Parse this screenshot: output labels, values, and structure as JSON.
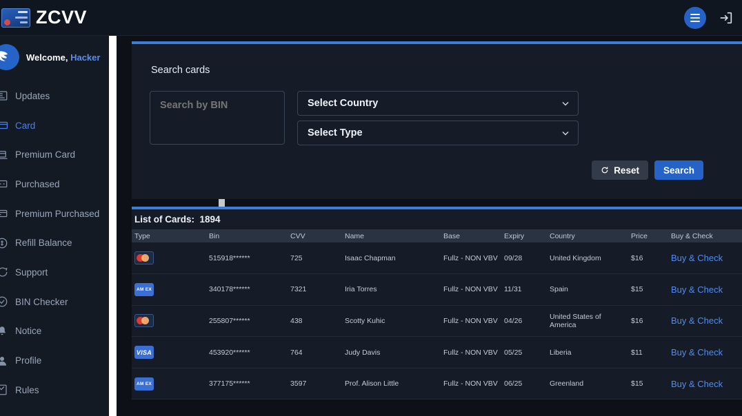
{
  "topbar": {
    "brand_name": "ZCVV",
    "brand_icon": "credit-card-icon",
    "menu_icon": "hamburger-menu-icon",
    "logout_icon": "logout-icon"
  },
  "sidebar": {
    "welcome_prefix": "Welcome,",
    "username": "Hacker",
    "avatar_icon": "user-avatar-icon",
    "items": [
      {
        "label": "Updates",
        "icon": "news-icon",
        "active": false
      },
      {
        "label": "Card",
        "icon": "card-icon",
        "active": true
      },
      {
        "label": "Premium Card",
        "icon": "premium-card-icon",
        "active": false
      },
      {
        "label": "Purchased",
        "icon": "purchased-icon",
        "active": false
      },
      {
        "label": "Premium Purchased",
        "icon": "premium-purchased-icon",
        "active": false
      },
      {
        "label": "Refill Balance",
        "icon": "refill-icon",
        "active": false
      },
      {
        "label": "Support",
        "icon": "support-chat-icon",
        "active": false
      },
      {
        "label": "BIN Checker",
        "icon": "bin-checker-icon",
        "active": false
      },
      {
        "label": "Notice",
        "icon": "bell-icon",
        "active": false
      },
      {
        "label": "Profile",
        "icon": "profile-icon",
        "active": false
      },
      {
        "label": "Rules",
        "icon": "rules-icon",
        "active": false
      }
    ]
  },
  "search_panel": {
    "title": "Search cards",
    "bin_placeholder": "Search by BIN",
    "bin_value": "",
    "country_label": "Select Country",
    "type_label": "Select Type",
    "reset_label": "Reset",
    "search_label": "Search",
    "reset_icon": "refresh-icon",
    "chevron_icon": "chevron-down-icon"
  },
  "list_panel": {
    "title_label": "List of Cards:",
    "count": "1894",
    "columns": [
      "Type",
      "Bin",
      "CVV",
      "Name",
      "Base",
      "Expiry",
      "Country",
      "Price",
      "Buy & Check"
    ],
    "buy_label": "Buy & Check",
    "rows": [
      {
        "type": "mastercard",
        "type_text": "",
        "bin": "515918******",
        "cvv": "725",
        "name": "Isaac Chapman",
        "base": "Fullz - NON VBV",
        "expiry": "09/28",
        "country": "United Kingdom",
        "price": "$16"
      },
      {
        "type": "amex",
        "type_text": "AM EX",
        "bin": "340178******",
        "cvv": "7321",
        "name": "Iria Torres",
        "base": "Fullz - NON VBV",
        "expiry": "11/31",
        "country": "Spain",
        "price": "$15"
      },
      {
        "type": "mastercard",
        "type_text": "",
        "bin": "255807******",
        "cvv": "438",
        "name": "Scotty Kuhic",
        "base": "Fullz - NON VBV",
        "expiry": "04/26",
        "country": "United States of America",
        "price": "$16"
      },
      {
        "type": "visa",
        "type_text": "VISA",
        "bin": "453920******",
        "cvv": "764",
        "name": "Judy Davis",
        "base": "Fullz - NON VBV",
        "expiry": "05/25",
        "country": "Liberia",
        "price": "$11"
      },
      {
        "type": "amex",
        "type_text": "AM EX",
        "bin": "377175******",
        "cvv": "3597",
        "name": "Prof. Alison Little",
        "base": "Fullz - NON VBV",
        "expiry": "06/25",
        "country": "Greenland",
        "price": "$15"
      }
    ]
  },
  "colors": {
    "accent": "#2563c7",
    "panel_top_border": "#3b7dd8",
    "page_bg": "#0d1117",
    "panel_bg": "#151c27",
    "link": "#4f8cf0",
    "active_nav": "#4f7fe8"
  }
}
